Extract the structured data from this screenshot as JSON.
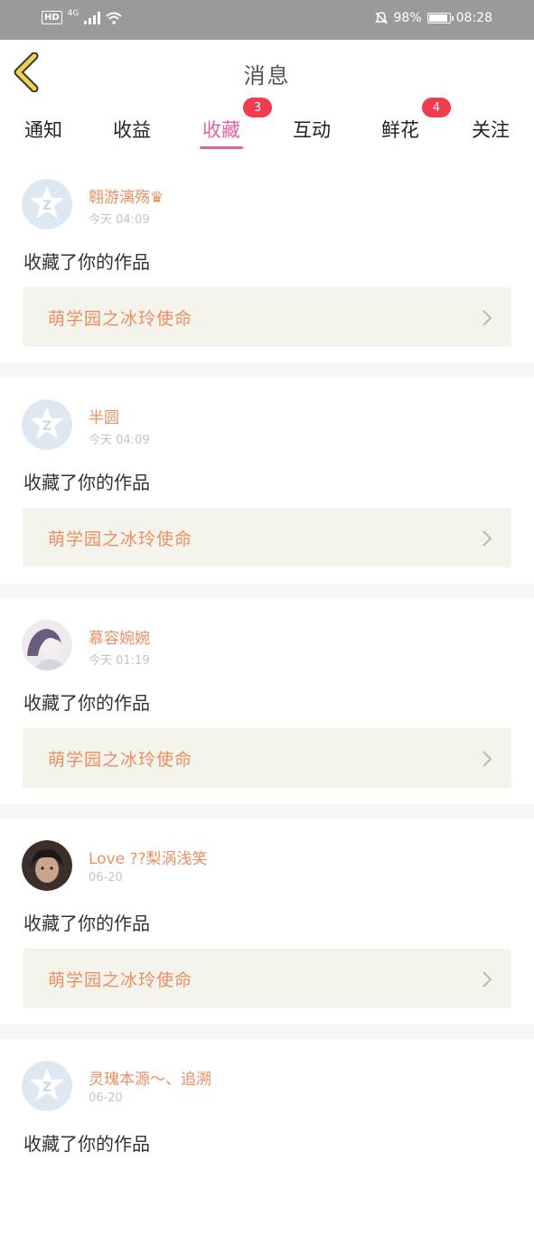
{
  "status_bar": {
    "hd": "HD",
    "network": "4G",
    "battery": "98%",
    "battery_level": 0.98,
    "time": "08:28"
  },
  "header": {
    "title": "消息"
  },
  "tabs": [
    {
      "label": "通知",
      "badge": null,
      "active": false
    },
    {
      "label": "收益",
      "badge": null,
      "active": false
    },
    {
      "label": "收藏",
      "badge": "3",
      "active": true
    },
    {
      "label": "互动",
      "badge": null,
      "active": false
    },
    {
      "label": "鲜花",
      "badge": "4",
      "active": false
    },
    {
      "label": "关注",
      "badge": null,
      "active": false
    }
  ],
  "messages": [
    {
      "user": "翱游漓殇♛",
      "time": "今天 04:09",
      "action": "收藏了你的作品",
      "work": "萌学园之冰玲使命",
      "avatar": "default-avatar"
    },
    {
      "user": "半圆",
      "time": "今天 04:09",
      "action": "收藏了你的作品",
      "work": "萌学园之冰玲使命",
      "avatar": "default-avatar"
    },
    {
      "user": "慕容婉婉",
      "time": "今天 01:19",
      "action": "收藏了你的作品",
      "work": "萌学园之冰玲使命",
      "avatar": "photo-avatar-girl"
    },
    {
      "user": "Love ??梨涡浅笑",
      "time": "06-20",
      "action": "收藏了你的作品",
      "work": "萌学园之冰玲使命",
      "avatar": "photo-avatar-boy"
    },
    {
      "user": "灵瑰本源～、追溯",
      "time": "06-20",
      "action": "收藏了你的作品",
      "work": "",
      "avatar": "default-avatar"
    }
  ],
  "colors": {
    "accent": "#e064a2",
    "badge": "#f23b4f",
    "username": "#e98f63",
    "work_bg": "#f5f4ec",
    "back_arrow": "#f2d24a"
  }
}
